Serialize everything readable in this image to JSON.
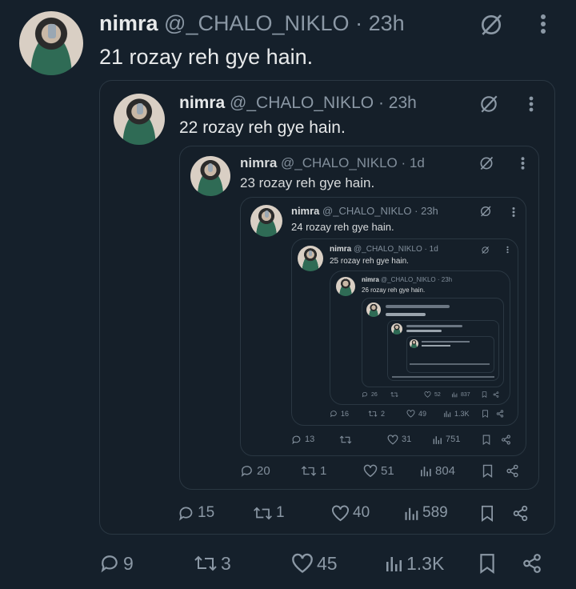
{
  "tweets": [
    {
      "name": "nimra",
      "handle": "@_CHALO_NIKLO",
      "time": "23h",
      "text": "21 rozay reh gye hain.",
      "replies": "9",
      "reposts": "3",
      "likes": "45",
      "views": "1.3K"
    },
    {
      "name": "nimra",
      "handle": "@_CHALO_NIKLO",
      "time": "23h",
      "text": "22 rozay reh gye hain.",
      "replies": "15",
      "reposts": "1",
      "likes": "40",
      "views": "589"
    },
    {
      "name": "nimra",
      "handle": "@_CHALO_NIKLO",
      "time": "1d",
      "text": "23 rozay reh gye hain.",
      "replies": "20",
      "reposts": "1",
      "likes": "51",
      "views": "804"
    },
    {
      "name": "nimra",
      "handle": "@_CHALO_NIKLO",
      "time": "23h",
      "text": "24 rozay reh gye hain.",
      "replies": "13",
      "reposts": "",
      "likes": "31",
      "views": "751"
    },
    {
      "name": "nimra",
      "handle": "@_CHALO_NIKLO",
      "time": "1d",
      "text": "25 rozay reh gye hain.",
      "replies": "16",
      "reposts": "2",
      "likes": "49",
      "views": "1.3K"
    },
    {
      "name": "nimra",
      "handle": "@_CHALO_NIKLO",
      "time": "23h",
      "text": "26 rozay reh gye hain.",
      "replies": "26",
      "reposts": "",
      "likes": "52",
      "views": "837"
    }
  ],
  "icons": {
    "grok": "slashed-circle-icon",
    "more": "more-icon"
  }
}
